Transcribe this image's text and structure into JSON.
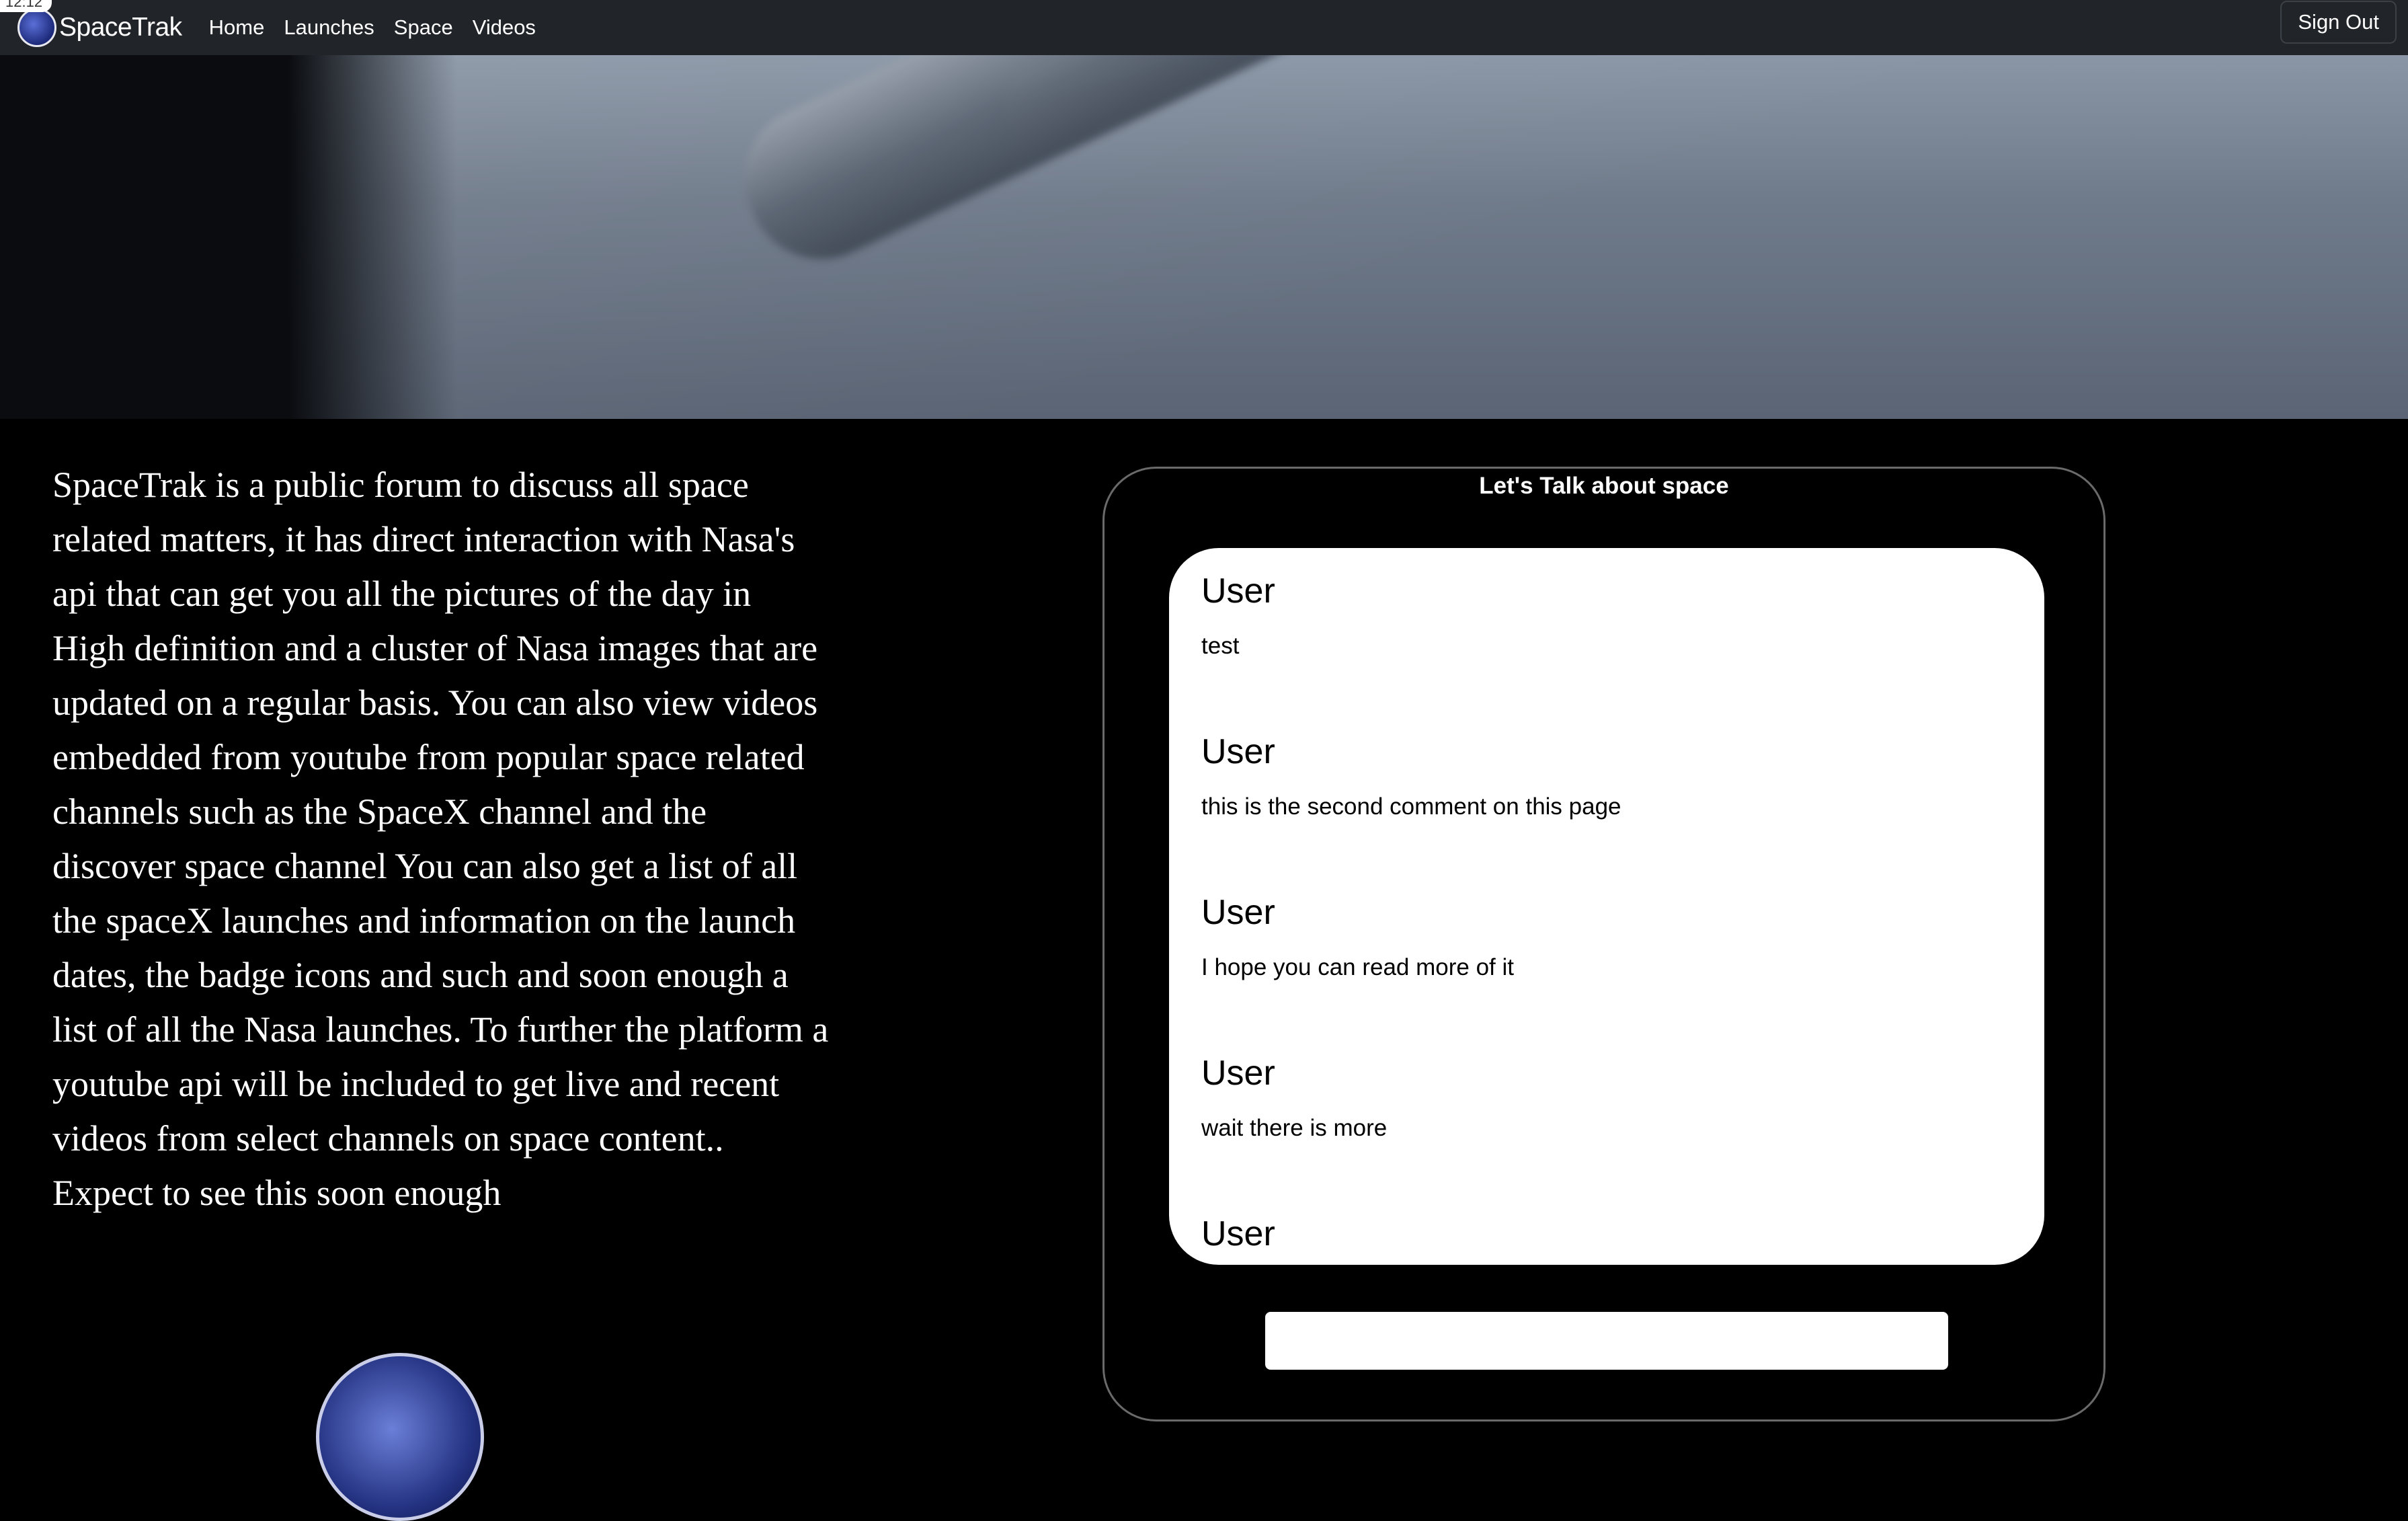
{
  "nav": {
    "time": "12:12",
    "brand": "SpaceTrak",
    "links": [
      "Home",
      "Launches",
      "Space",
      "Videos"
    ],
    "signout": "Sign Out"
  },
  "about": {
    "text": "SpaceTrak is a public forum to discuss all space related matters, it has direct interaction with Nasa's api that can get you all the pictures of the day in High definition and a cluster of Nasa images that are updated on a regular basis. You can also view videos embedded from youtube from popular space related channels such as the SpaceX channel and the discover space channel You can also get a list of all the spaceX launches and information on the launch dates, the badge icons and such and soon enough a list of all the Nasa launches. To further the platform a youtube api will be included to get live and recent videos from select channels on space content.. Expect to see this soon enough"
  },
  "chat": {
    "title": "Let's Talk about space",
    "comments": [
      {
        "author": "User",
        "text": "test"
      },
      {
        "author": "User",
        "text": "this is the second comment on this page"
      },
      {
        "author": "User",
        "text": "I hope you can read more of it"
      },
      {
        "author": "User",
        "text": "wait there is more"
      },
      {
        "author": "User",
        "text": ""
      }
    ],
    "input_value": ""
  }
}
